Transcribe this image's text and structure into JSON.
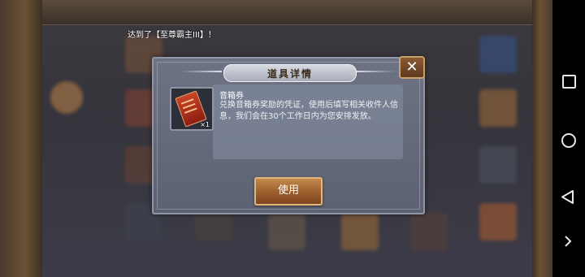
{
  "notice": {
    "text": "达到了【至尊霸主III】！"
  },
  "dialog": {
    "title": "道具详情",
    "close_glyph": "✕",
    "item": {
      "icon": "red-ticket-icon",
      "quantity": "×1",
      "name": "音箱券",
      "description": "兑换音箱券奖励的凭证，使用后填写相关收件人信息，我们会在30个工作日内为您安排发放。"
    },
    "use_button": "使用"
  },
  "navbar": {
    "recents": "square-icon",
    "home": "circle-icon",
    "back": "triangle-back-icon",
    "expand": "chevron-right-icon"
  },
  "colors": {
    "accent_button": "#9b5e2c",
    "dialog_bg": "#6e7384",
    "close_button": "#7a4c2a"
  }
}
